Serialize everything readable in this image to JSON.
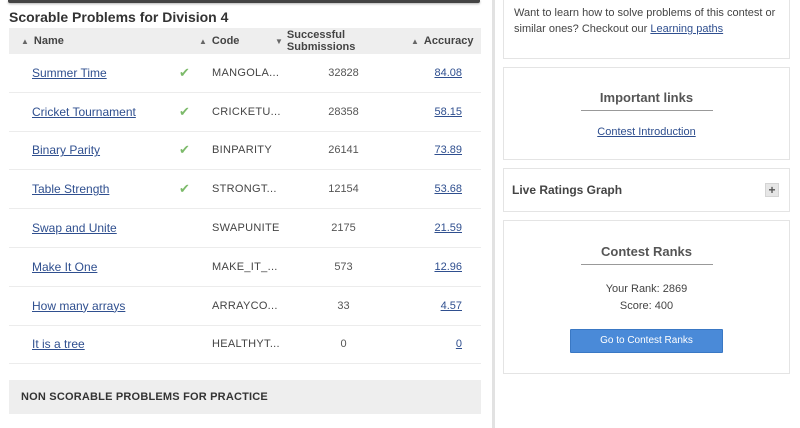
{
  "section_title": "Scorable Problems for Division 4",
  "table": {
    "headers": {
      "name": "Name",
      "code": "Code",
      "successful": "Successful Submissions",
      "accuracy": "Accuracy"
    },
    "rows": [
      {
        "name": "Summer Time",
        "solved": true,
        "code": "MANGOLA...",
        "successful": "32828",
        "accuracy": "84.08"
      },
      {
        "name": "Cricket Tournament",
        "solved": true,
        "code": "CRICKETU...",
        "successful": "28358",
        "accuracy": "58.15"
      },
      {
        "name": "Binary Parity",
        "solved": true,
        "code": "BINPARITY",
        "successful": "26141",
        "accuracy": "73.89"
      },
      {
        "name": "Table Strength",
        "solved": true,
        "code": "STRONGT...",
        "successful": "12154",
        "accuracy": "53.68"
      },
      {
        "name": "Swap and Unite",
        "solved": false,
        "code": "SWAPUNITE",
        "successful": "2175",
        "accuracy": "21.59"
      },
      {
        "name": "Make It One",
        "solved": false,
        "code": "MAKE_IT_...",
        "successful": "573",
        "accuracy": "12.96"
      },
      {
        "name": "How many arrays",
        "solved": false,
        "code": "ARRAYCO...",
        "successful": "33",
        "accuracy": "4.57"
      },
      {
        "name": "It is a tree",
        "solved": false,
        "code": "HEALTHYT...",
        "successful": "0",
        "accuracy": "0"
      }
    ]
  },
  "non_scorable": "NON SCORABLE PROBLEMS FOR PRACTICE",
  "learn": {
    "text": "Want to learn how to solve problems of this contest or similar ones? Checkout our",
    "link": "Learning paths"
  },
  "important_links": {
    "title": "Important links",
    "link": "Contest Introduction"
  },
  "live_graph": {
    "title": "Live Ratings Graph",
    "toggle": "+"
  },
  "contest_ranks": {
    "title": "Contest Ranks",
    "your_rank": "Your Rank: 2869",
    "score": "Score: 400",
    "button": "Go to Contest Ranks"
  },
  "colors": {
    "link": "#2f4f8f",
    "check": "#7cba6a",
    "button": "#4a8ad8"
  },
  "icons": {
    "sort": "sort-icon",
    "sort_desc": "sort-desc-icon",
    "check": "check-icon",
    "expand": "plus-icon"
  }
}
